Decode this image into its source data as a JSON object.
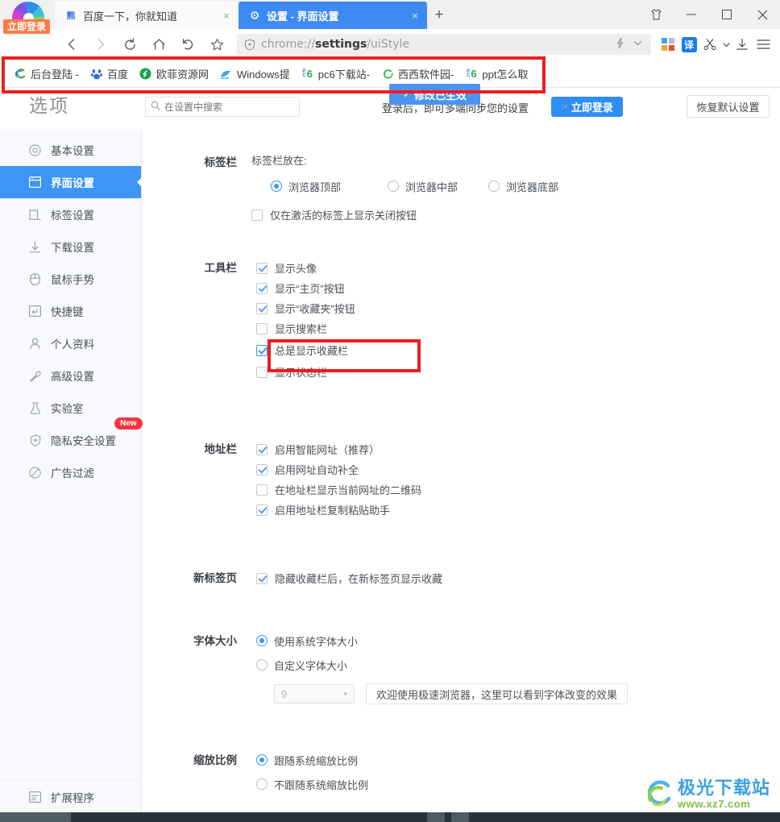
{
  "window": {
    "controls": [
      {
        "name": "shirt-icon",
        "glyph": "ὅ5"
      },
      {
        "name": "minimize",
        "glyph": "—"
      },
      {
        "name": "maximize",
        "glyph": "□"
      },
      {
        "name": "close",
        "glyph": "✕"
      }
    ]
  },
  "tabs": [
    {
      "title": "百度一下，你就知道",
      "favicon": "baidu-paw-icon",
      "active": false,
      "close": "×"
    },
    {
      "title": "设置 - 界面设置",
      "favicon": "gear-icon",
      "active": true,
      "close": "×"
    }
  ],
  "newtab_label": "+",
  "logo": {
    "login_badge": "立即登录"
  },
  "nav": {
    "back": "‹",
    "forward": "›",
    "reload": "⟳",
    "home": "⌂",
    "undo": "↶",
    "star": "☆"
  },
  "omnibox": {
    "shield_icon": "shield-plus-icon",
    "url_prefix": "chrome://",
    "url_bold": "settings",
    "url_suffix": "/uiStyle",
    "lightning_icon": "⚡",
    "chevron_icon": "∨"
  },
  "toolbar_icons": [
    {
      "name": "microsoft-apps-icon",
      "glyph": ""
    },
    {
      "name": "translate-icon",
      "glyph": "译"
    },
    {
      "name": "scissors-icon",
      "glyph": "✂"
    },
    {
      "name": "scissors-dropdown-icon",
      "glyph": "▾"
    },
    {
      "name": "download-icon",
      "glyph": "↓"
    },
    {
      "name": "menu-icon",
      "glyph": "≡"
    }
  ],
  "bookmarks": [
    {
      "label": "后台登陆 -",
      "icon": "spiral-icon",
      "icon_glyph": "◔",
      "icon_color": "#4aa84a"
    },
    {
      "label": "百度",
      "icon": "baidu-icon",
      "icon_glyph": "❀",
      "icon_color": "#2b6ed9"
    },
    {
      "label": "欧菲资源网",
      "icon": "oufei-icon",
      "icon_glyph": "◐",
      "icon_color": "#1aa84a"
    },
    {
      "label": "Windows提",
      "icon": "windows-tips-icon",
      "icon_glyph": "⬟",
      "icon_color": "#3aa8e8"
    },
    {
      "label": "pc6下载站-",
      "icon": "pc6-icon",
      "icon_glyph": "6",
      "icon_color": "#2faa4a"
    },
    {
      "label": "西西软件园-",
      "icon": "xixi-icon",
      "icon_glyph": "G",
      "icon_color": "#2faa4a"
    },
    {
      "label": "ppt怎么取",
      "icon": "pc6-icon",
      "icon_glyph": "6",
      "icon_color": "#2faa4a"
    }
  ],
  "header": {
    "title": "选项",
    "search_placeholder": "在设置中搜索",
    "search_value": "",
    "search_icon": "search-icon",
    "sync_text": "登录后，即可多端同步您的设置",
    "login_button": "立即登录",
    "restore_button": "恢复默认设置",
    "toast": "修改已生效",
    "toast_check": "✓"
  },
  "sidebar": {
    "items": [
      {
        "label": "基本设置",
        "icon": "circle-target-icon",
        "glyph": "◎",
        "active": false
      },
      {
        "label": "界面设置",
        "icon": "window-layout-icon",
        "glyph": "▤",
        "active": true
      },
      {
        "label": "标签设置",
        "icon": "tab-icon",
        "glyph": "⊓",
        "active": false
      },
      {
        "label": "下载设置",
        "icon": "download-arrow-icon",
        "glyph": "⤓",
        "active": false
      },
      {
        "label": "鼠标手势",
        "icon": "mouse-icon",
        "glyph": "◔",
        "active": false
      },
      {
        "label": "快捷键",
        "icon": "keyboard-key-icon",
        "glyph": "⏎",
        "active": false
      },
      {
        "label": "个人资料",
        "icon": "person-icon",
        "glyph": "⚹",
        "active": false
      },
      {
        "label": "高级设置",
        "icon": "wrench-icon",
        "glyph": "⚒",
        "active": false
      },
      {
        "label": "实验室",
        "icon": "flask-icon",
        "glyph": "⚗",
        "active": false
      },
      {
        "label": "隐私安全设置",
        "icon": "shield-plus-icon",
        "glyph": "⊕",
        "active": false,
        "badge": "New"
      },
      {
        "label": "广告过滤",
        "icon": "block-icon",
        "glyph": "⊘",
        "active": false
      }
    ],
    "bottom_item": {
      "label": "扩展程序",
      "icon": "extensions-icon",
      "glyph": "▤"
    }
  },
  "sections": [
    {
      "id": "tabbar",
      "label": "标签栏",
      "sub_label": "标签栏放在:",
      "radios": [
        {
          "label": "浏览器顶部",
          "checked": true
        },
        {
          "label": "浏览器中部",
          "checked": false
        },
        {
          "label": "浏览器底部",
          "checked": false
        }
      ],
      "checkboxes": [
        {
          "label": "仅在激活的标签上显示关闭按钮",
          "checked": false
        }
      ]
    },
    {
      "id": "toolbar",
      "label": "工具栏",
      "checkboxes": [
        {
          "label": "显示头像",
          "checked": true
        },
        {
          "label": "显示“主页”按钮",
          "checked": true
        },
        {
          "label": "显示“收藏夹”按钮",
          "checked": true
        },
        {
          "label": "显示搜索栏",
          "checked": false
        },
        {
          "label": "总是显示收藏栏",
          "checked": true,
          "highlighted": true
        },
        {
          "label": "显示状态栏",
          "checked": false
        }
      ]
    },
    {
      "id": "addressbar",
      "label": "地址栏",
      "checkboxes": [
        {
          "label": "启用智能网址（推荐）",
          "checked": true
        },
        {
          "label": "启用网址自动补全",
          "checked": true
        },
        {
          "label": "在地址栏显示当前网址的二维码",
          "checked": false
        },
        {
          "label": "启用地址栏复制粘贴助手",
          "checked": true
        }
      ]
    },
    {
      "id": "newtabpage",
      "label": "新标签页",
      "checkboxes": [
        {
          "label": "隐藏收藏栏后，在新标签页显示收藏",
          "checked": true
        }
      ]
    },
    {
      "id": "fontsize",
      "label": "字体大小",
      "radios": [
        {
          "label": "使用系统字体大小",
          "checked": true
        },
        {
          "label": "自定义字体大小",
          "checked": false
        }
      ],
      "select_value": "9",
      "select_caret": "▾",
      "preview_text": "欢迎使用极速浏览器，这里可以看到字体改变的效果"
    },
    {
      "id": "zoomratio",
      "label": "缩放比例",
      "radios": [
        {
          "label": "跟随系统缩放比例",
          "checked": true
        },
        {
          "label": "不跟随系统缩放比例",
          "checked": false
        }
      ]
    }
  ],
  "annotations": [
    {
      "name": "redbox-bookmarkbar",
      "color": "#ef1d1d"
    },
    {
      "name": "redbox-option",
      "color": "#ef1d1d"
    }
  ],
  "watermark": {
    "main": "极光下载站",
    "sub": "www.xz7.com"
  },
  "colors": {
    "accent": "#3d95f5",
    "active_tab": "#3d8bf2",
    "sidebar_bg": "#f7f9fc",
    "annotation_red": "#ef1d1d",
    "badge_red": "#f5333f",
    "login_orange": "#ff7a45"
  }
}
